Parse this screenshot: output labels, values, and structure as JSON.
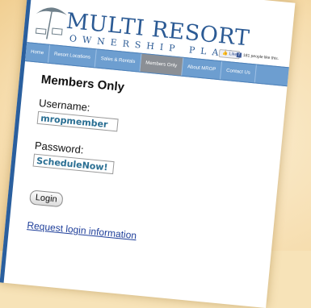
{
  "brand": {
    "name": "MULTI RESORT",
    "tagline": "OWNERSHIP PLAN"
  },
  "social": {
    "like_label": "Like",
    "like_count_text": "181 people like this."
  },
  "nav": {
    "items": [
      {
        "label": "Home"
      },
      {
        "label": "Resort Locations"
      },
      {
        "label": "Sales & Rentals"
      },
      {
        "label": "Members Only",
        "active": true
      },
      {
        "label": "About MROP"
      },
      {
        "label": "Contact Us"
      }
    ]
  },
  "login": {
    "title": "Members Only",
    "username_label": "Username:",
    "username_value": "mropmember",
    "password_label": "Password:",
    "password_value": "ScheduleNow!",
    "submit_label": "Login",
    "request_link": "Request login information"
  },
  "colors": {
    "accent": "#2b5a94",
    "nav_bg": "#6d9ed0",
    "nav_active": "#8b8f95",
    "background": "#f7e3b8"
  },
  "icons": [
    "beach-umbrella-icon",
    "facebook-icon",
    "thumbs-up-icon"
  ]
}
